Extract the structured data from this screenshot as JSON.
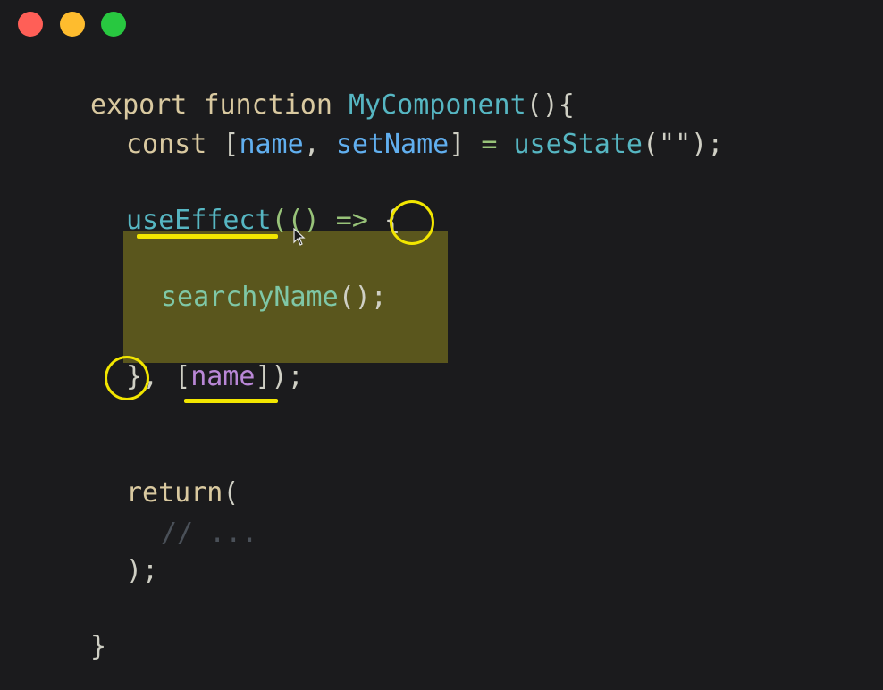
{
  "window_controls": {
    "close_color": "#ff5f57",
    "minimize_color": "#febc2e",
    "maximize_color": "#28c840"
  },
  "code": {
    "line1": {
      "kw1": "export",
      "kw2": "function",
      "name": "MyComponent",
      "rest": "(){"
    },
    "line2": {
      "kw": "const",
      "open": "[",
      "v1": "name",
      "comma": ",",
      "v2": "setName",
      "close": "]",
      "eq": "=",
      "fn": "useState",
      "args": "(\"\");"
    },
    "line3": {
      "fn": "useEffect",
      "args": "(() =>",
      "brace": "{"
    },
    "line4": {
      "fn": "searchyName",
      "rest": "();"
    },
    "line5": {
      "brace": "}",
      "comma": ",",
      "open": "[",
      "dep": "name",
      "close": "]);"
    },
    "line6": {
      "kw": "return",
      "rest": "("
    },
    "line7": {
      "comment": "// ..."
    },
    "line8": {
      "rest": ");"
    },
    "line9": {
      "rest": "}"
    }
  },
  "annotations": {
    "highlight_color": "#5a561d",
    "marker_color": "#f2e600"
  }
}
